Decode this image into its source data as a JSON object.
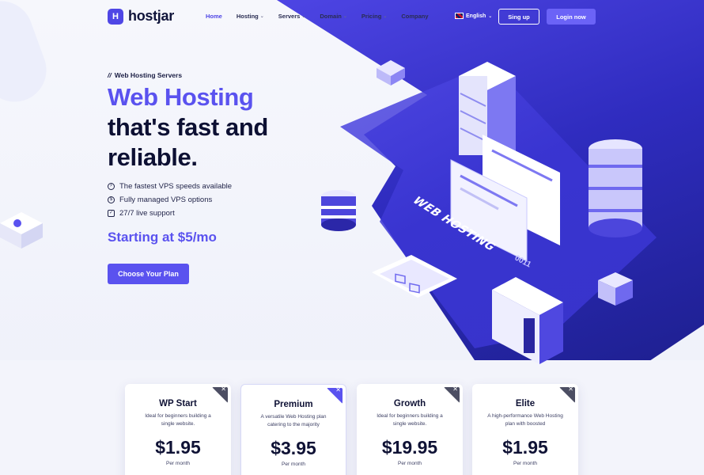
{
  "brand": {
    "logo_letter": "H",
    "name": "hostjar"
  },
  "nav": {
    "items": [
      {
        "label": "Home",
        "caret": false,
        "active": true
      },
      {
        "label": "Hosting",
        "caret": true,
        "active": false
      },
      {
        "label": "Servers",
        "caret": true,
        "active": false
      },
      {
        "label": "Domain",
        "caret": true,
        "active": false
      },
      {
        "label": "Pricing",
        "caret": true,
        "active": false
      },
      {
        "label": "Company",
        "caret": false,
        "active": false
      }
    ],
    "language": "English",
    "signup_label": "Sing up",
    "login_label": "Login now"
  },
  "hero": {
    "eyebrow": "Web Hosting Servers",
    "headline_accent": "Web Hosting",
    "headline_line2": "that's fast and",
    "headline_line3": "reliable.",
    "features": [
      {
        "icon": "speed-icon",
        "text": "The fastest VPS speeds available"
      },
      {
        "icon": "managed-icon",
        "text": "Fully managed VPS options"
      },
      {
        "icon": "support-icon",
        "text": "27/7 live support"
      }
    ],
    "starting_text": "Starting at $5/mo",
    "cta_label": "Choose Your Plan",
    "illustration_label": "WEB HOSTING",
    "illustration_code": "0011"
  },
  "plans": [
    {
      "name": "WP Start",
      "desc": "Ideal for beginners building a single website.",
      "price": "$1.95",
      "period": "Per month",
      "featured": false
    },
    {
      "name": "Premium",
      "desc": "A versatile Web Hosting plan catering to the majority",
      "price": "$3.95",
      "period": "Per month",
      "featured": true
    },
    {
      "name": "Growth",
      "desc": "Ideal for beginners building a single website.",
      "price": "$19.95",
      "period": "Per month",
      "featured": false
    },
    {
      "name": "Elite",
      "desc": "A high-performance Web Hosting plan with boosted",
      "price": "$1.95",
      "period": "Per month",
      "featured": false
    }
  ],
  "colors": {
    "accent": "#5a52ef",
    "dark": "#0f1235",
    "hero_bg": "#3b36d4"
  }
}
